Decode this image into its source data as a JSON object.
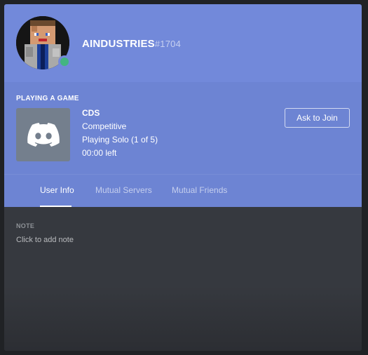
{
  "profile": {
    "username": "AINDUSTRIES",
    "discriminator": "#1704",
    "status_color": "#43b581"
  },
  "activity": {
    "header": "PLAYING A GAME",
    "game_name": "CDS",
    "details": "Competitive",
    "party": "Playing Solo (1 of 5)",
    "time": "00:00 left",
    "join_button": "Ask to Join",
    "icon": "discord-logo-icon"
  },
  "tabs": [
    {
      "label": "User Info",
      "active": true
    },
    {
      "label": "Mutual Servers",
      "active": false
    },
    {
      "label": "Mutual Friends",
      "active": false
    }
  ],
  "note": {
    "label": "NOTE",
    "placeholder": "Click to add note"
  },
  "colors": {
    "brand": "#7289da",
    "background": "#36393f"
  }
}
